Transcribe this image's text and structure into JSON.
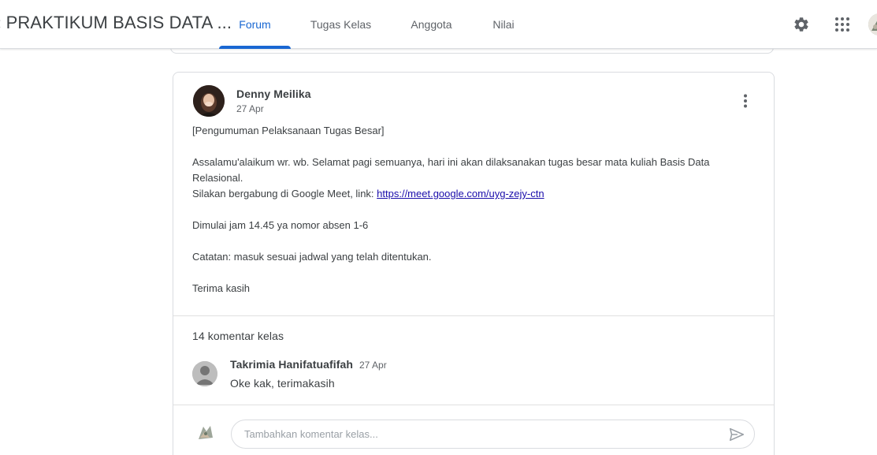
{
  "header": {
    "class_title": "PRAKTIKUM BASIS DATA ...",
    "tabs": [
      {
        "label": "Forum",
        "active": true
      },
      {
        "label": "Tugas Kelas",
        "active": false
      },
      {
        "label": "Anggota",
        "active": false
      },
      {
        "label": "Nilai",
        "active": false
      }
    ],
    "icons": [
      "settings-icon",
      "apps-grid-icon",
      "account-avatar"
    ],
    "accent_color": "#1967d2"
  },
  "post": {
    "author": "Denny Meilika",
    "date": "27 Apr",
    "title": "[Pengumuman Pelaksanaan Tugas Besar]",
    "greeting": "Assalamu'alaikum wr. wb. Selamat pagi semuanya, hari ini akan dilaksanakan tugas besar mata kuliah Basis Data Relasional.",
    "meet_text": "Silakan bergabung di Google Meet, link: ",
    "meet_link": "https://meet.google.com/uyg-zejy-ctn",
    "schedule": "Dimulai jam 14.45 ya nomor absen 1-6",
    "note": "Catatan: masuk sesuai jadwal yang telah ditentukan.",
    "closing": "Terima kasih"
  },
  "comments": {
    "count_label": "14 komentar kelas",
    "items": [
      {
        "author": "Takrimia Hanifatuafifah",
        "date": "27 Apr",
        "text": "Oke kak, terimakasih"
      }
    ],
    "input_placeholder": "Tambahkan komentar kelas..."
  }
}
